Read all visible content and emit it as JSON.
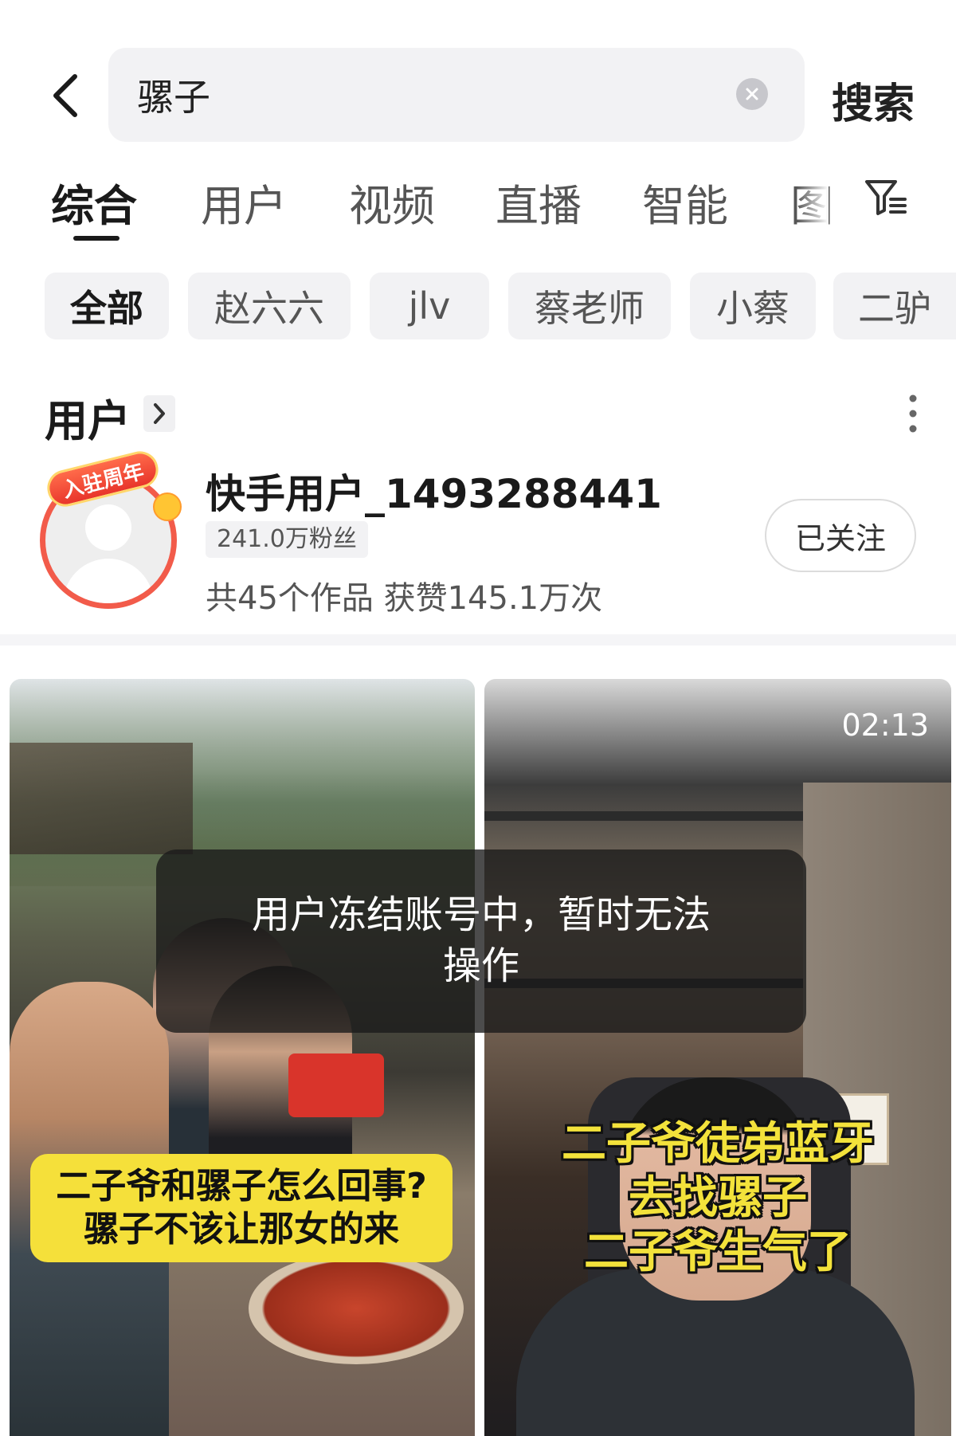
{
  "search": {
    "query": "骡子",
    "submit_label": "搜索"
  },
  "tabs": [
    {
      "label": "综合",
      "active": true
    },
    {
      "label": "用户"
    },
    {
      "label": "视频"
    },
    {
      "label": "直播"
    },
    {
      "label": "智能"
    },
    {
      "label": "图"
    }
  ],
  "chips": [
    {
      "label": "全部",
      "active": true
    },
    {
      "label": "赵六六"
    },
    {
      "label": "jlv"
    },
    {
      "label": "蔡老师"
    },
    {
      "label": "小蔡"
    },
    {
      "label": "二驴"
    }
  ],
  "users_section": {
    "title": "用户"
  },
  "user": {
    "badge": "入驻周年",
    "name": "快手用户_1493288441",
    "fans": "241.0万粉丝",
    "stats": "共45个作品 获赞145.1万次",
    "follow_label": "已关注"
  },
  "videos": [
    {
      "caption_lines": [
        "二子爷和骡子怎么回事?",
        "骡子不该让那女的来"
      ]
    },
    {
      "duration": "02:13",
      "caption_lines": [
        "二子爷徒弟蓝牙",
        "去找骡子",
        "二子爷生气了"
      ]
    }
  ],
  "toast": {
    "line1": "用户冻结账号中，暂时无法",
    "line2": "操作"
  },
  "colors": {
    "accent_red": "#f25b4a",
    "caption_yellow": "#f5e03a",
    "chip_bg": "#f2f2f4"
  }
}
